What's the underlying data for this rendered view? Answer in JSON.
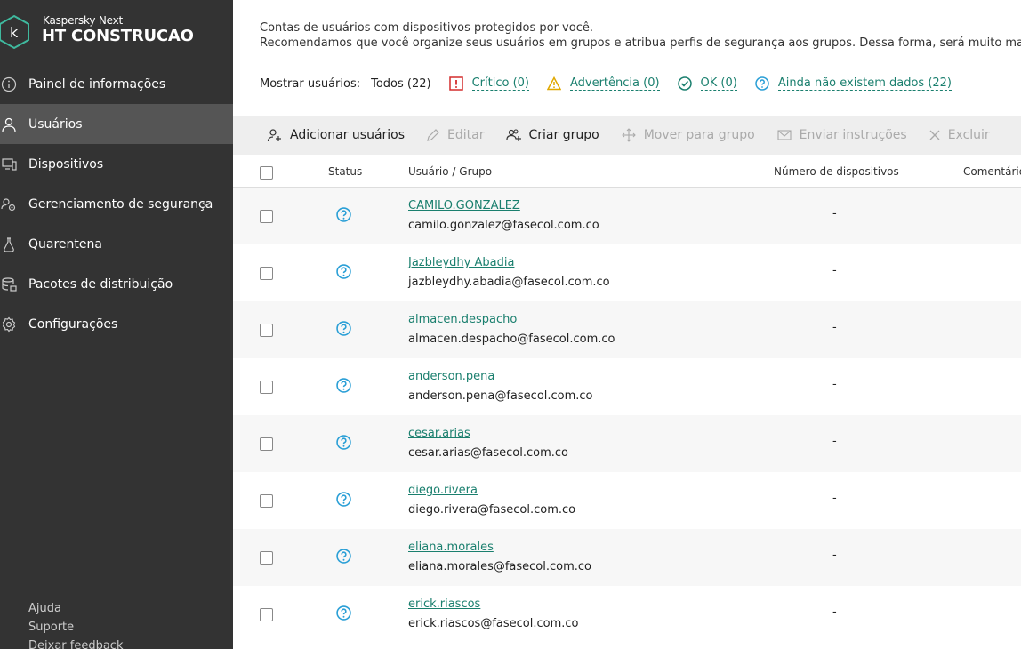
{
  "brand": {
    "sub": "Kaspersky Next",
    "main": "HT CONSTRUCAO"
  },
  "nav": [
    {
      "label": "Painel de informações",
      "icon": "info-circle-icon"
    },
    {
      "label": "Usuários",
      "icon": "user-icon",
      "active": true
    },
    {
      "label": "Dispositivos",
      "icon": "devices-icon"
    },
    {
      "label": "Gerenciamento de segurança",
      "icon": "security-management-icon",
      "expandable": true
    },
    {
      "label": "Quarentena",
      "icon": "quarantine-flask-icon"
    },
    {
      "label": "Pacotes de distribuição",
      "icon": "distribution-packages-icon"
    },
    {
      "label": "Configurações",
      "icon": "gear-icon"
    }
  ],
  "footer": {
    "help": "Ajuda",
    "support": "Suporte",
    "feedback": "Deixar feedback"
  },
  "description": {
    "line1": "Contas de usuários com dispositivos protegidos por você.",
    "line2": "Recomendamos que você organize seus usuários em grupos e atribua perfis de segurança aos grupos. Dessa forma, será muito mais fác"
  },
  "filters": {
    "label": "Mostrar usuários:",
    "all": "Todos (22)",
    "critical": "Crítico (0)",
    "warning": "Advertência (0)",
    "ok": "OK (0)",
    "nodata": "Ainda não existem dados (22)"
  },
  "toolbar": {
    "add_users": "Adicionar usuários",
    "edit": "Editar",
    "create_group": "Criar grupo",
    "move_to_group": "Mover para grupo",
    "send_instructions": "Enviar instruções",
    "delete": "Excluir"
  },
  "table": {
    "headers": {
      "status": "Status",
      "user_group": "Usuário / Grupo",
      "devices": "Número de dispositivos",
      "comment": "Comentário"
    },
    "rows": [
      {
        "name": "CAMILO.GONZALEZ",
        "email": "camilo.gonzalez@fasecol.com.co",
        "devices": "-"
      },
      {
        "name": "Jazbleydhy Abadia",
        "email": "jazbleydhy.abadia@fasecol.com.co",
        "devices": "-"
      },
      {
        "name": "almacen.despacho",
        "email": "almacen.despacho@fasecol.com.co",
        "devices": "-"
      },
      {
        "name": "anderson.pena",
        "email": "anderson.pena@fasecol.com.co",
        "devices": "-"
      },
      {
        "name": "cesar.arias",
        "email": "cesar.arias@fasecol.com.co",
        "devices": "-"
      },
      {
        "name": "diego.rivera",
        "email": "diego.rivera@fasecol.com.co",
        "devices": "-"
      },
      {
        "name": "eliana.morales",
        "email": "eliana.morales@fasecol.com.co",
        "devices": "-"
      },
      {
        "name": "erick.riascos",
        "email": "erick.riascos@fasecol.com.co",
        "devices": "-"
      }
    ]
  },
  "colors": {
    "sidebar_bg": "#333333",
    "accent": "#1a7f6e",
    "critical": "#d42d2d",
    "warning": "#e0a800",
    "status_unknown": "#2a9fd6"
  }
}
